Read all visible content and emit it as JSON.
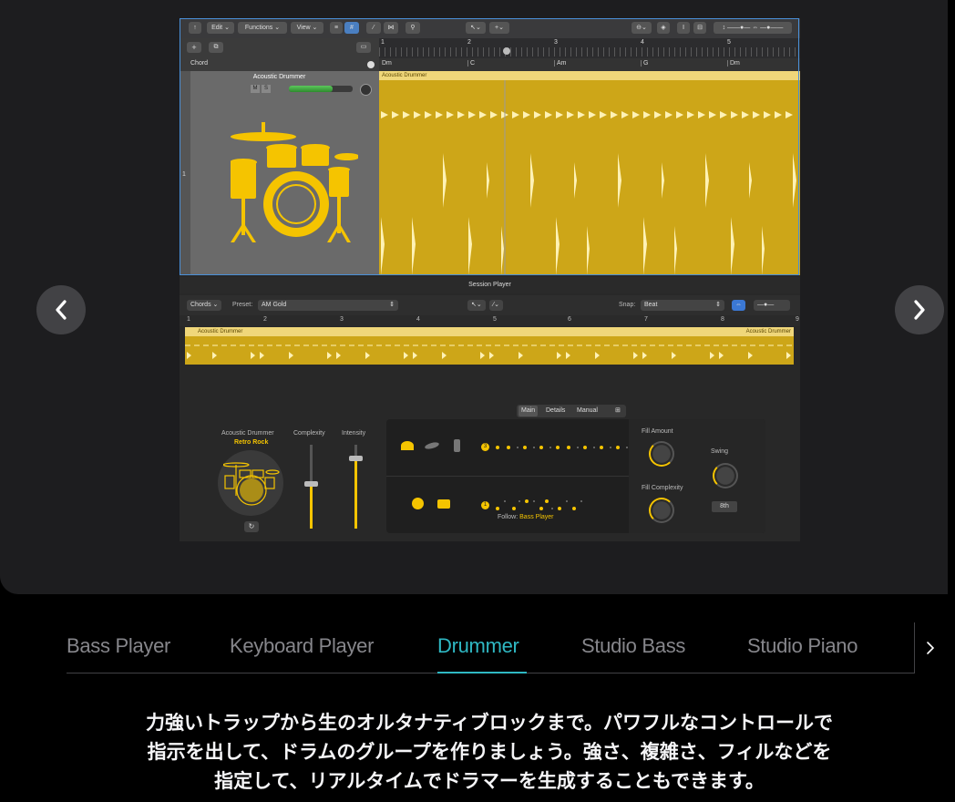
{
  "screenshot": {
    "toolbar": {
      "edit": "Edit",
      "functions": "Functions",
      "view": "View"
    },
    "chord_label": "Chord",
    "track": {
      "name": "Acoustic Drummer",
      "mute": "M",
      "solo": "S",
      "number": "1"
    },
    "ruler_bars": [
      "1",
      "2",
      "3",
      "4",
      "5"
    ],
    "chords": [
      "Dm",
      "C",
      "Am",
      "G",
      "Dm"
    ],
    "region_name": "Acoustic Drummer",
    "session_player": {
      "title": "Session Player",
      "chords_menu": "Chords",
      "preset_label": "Preset:",
      "preset_value": "AM Gold",
      "snap_label": "Snap:",
      "snap_value": "Beat",
      "ruler_bars": [
        "1",
        "2",
        "3",
        "4",
        "5",
        "6",
        "7",
        "8",
        "9"
      ],
      "region_name_left": "Acoustic Drummer",
      "region_name_right": "Acoustic Drummer"
    },
    "drummer_panel": {
      "tabs": [
        "Main",
        "Details",
        "Manual"
      ],
      "drummer_name": "Acoustic Drummer",
      "drummer_style": "Retro Rock",
      "complexity_label": "Complexity",
      "intensity_label": "Intensity",
      "row1_number": "3",
      "row2_number": "1",
      "follow_label": "Follow:",
      "follow_value": "Bass Player",
      "fill_amount_label": "Fill Amount",
      "fill_complexity_label": "Fill Complexity",
      "swing_label": "Swing",
      "swing_value": "8th"
    }
  },
  "tabs": [
    {
      "label": "Bass Player",
      "active": false
    },
    {
      "label": "Keyboard Player",
      "active": false
    },
    {
      "label": "Drummer",
      "active": true
    },
    {
      "label": "Studio Bass",
      "active": false
    },
    {
      "label": "Studio Piano",
      "active": false
    }
  ],
  "description": {
    "line1": "力強いトラップから生のオルタナティブロックまで。パワフルなコントロールで",
    "line2": "指示を出して、ドラムのグループを作りましょう。強さ、複雑さ、フィルなどを",
    "line3": "指定して、リアルタイムでドラマーを生成することもできます。"
  },
  "colors": {
    "accent": "#2fb8c3",
    "region": "#cda618",
    "drum_yellow": "#f5c400",
    "stage_bg": "#1d1d1f"
  },
  "icons": [
    "chevron-left-icon",
    "chevron-right-icon",
    "drum-kit-icon",
    "cymbal-icon",
    "snare-icon",
    "kick-icon",
    "refresh-icon"
  ]
}
